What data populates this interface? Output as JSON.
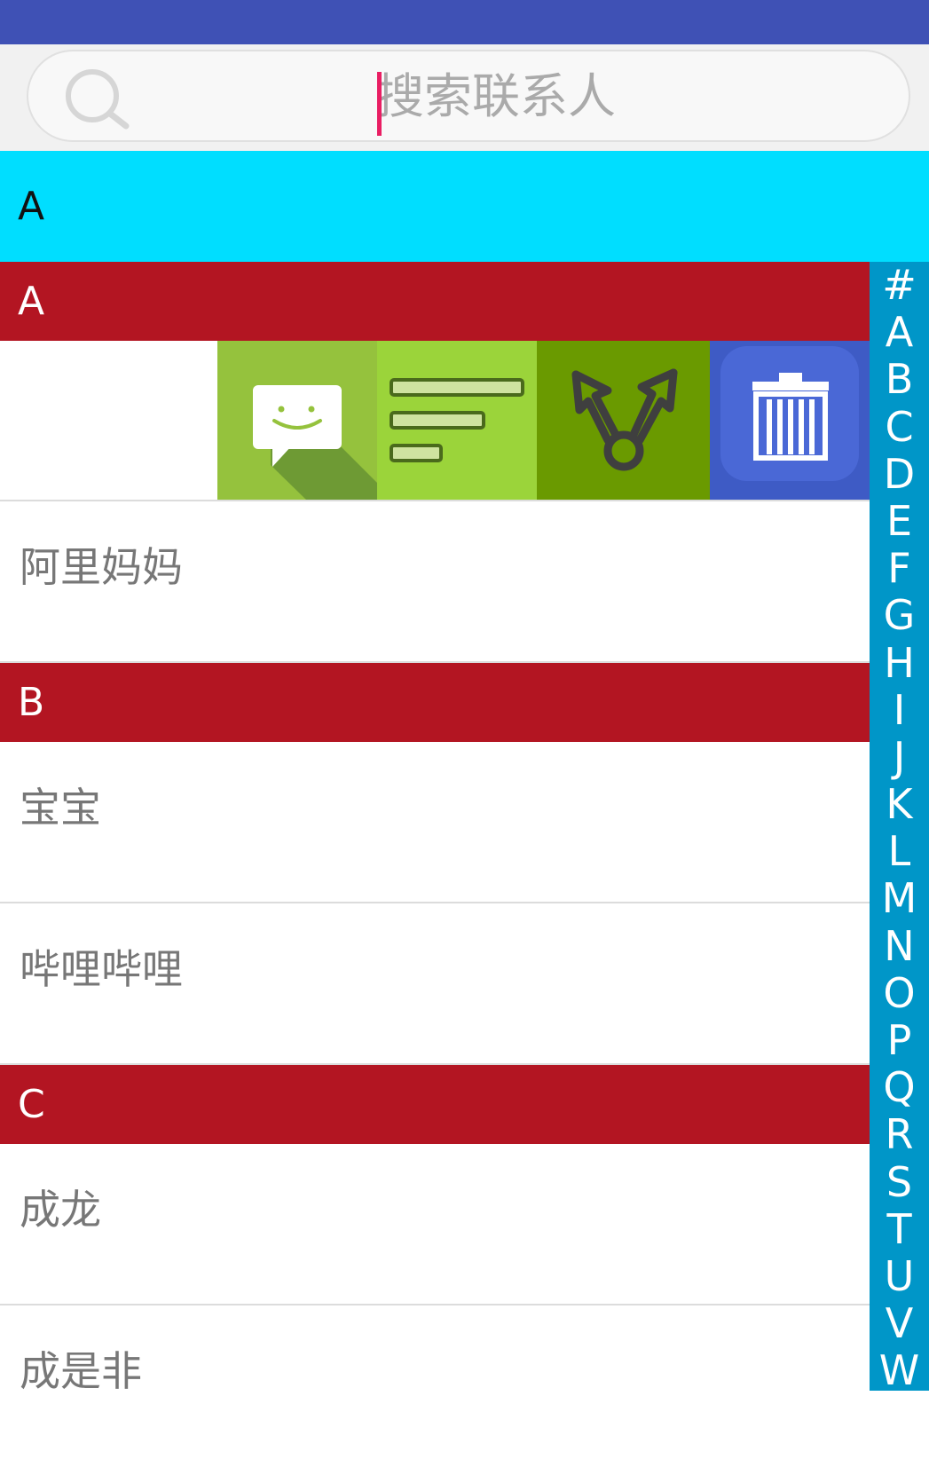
{
  "search": {
    "placeholder": "搜索联系人"
  },
  "sticky_header": "A",
  "sections": [
    {
      "letter": "A",
      "contacts": [
        "阿里妈妈"
      ]
    },
    {
      "letter": "B",
      "contacts": [
        "宝宝",
        "哔哩哔哩"
      ]
    },
    {
      "letter": "C",
      "contacts": [
        "成龙",
        "成是非"
      ]
    }
  ],
  "swipe_actions": [
    {
      "icon": "message-smiley-icon",
      "color": "#95c23d"
    },
    {
      "icon": "list-lines-icon",
      "color": "#9bd43a"
    },
    {
      "icon": "share-arrows-icon",
      "color": "#6a9a00"
    },
    {
      "icon": "trash-icon",
      "color": "#3e5bc5"
    }
  ],
  "index_letters": [
    "#",
    "A",
    "B",
    "C",
    "D",
    "E",
    "F",
    "G",
    "H",
    "I",
    "J",
    "K",
    "L",
    "M",
    "N",
    "O",
    "P",
    "Q",
    "R",
    "S",
    "T",
    "U",
    "V",
    "W"
  ],
  "colors": {
    "status_bar": "#3f51b5",
    "sticky_header": "#00deff",
    "section_header": "#b31522",
    "index_bar": "#0096c8",
    "caret": "#e91e63"
  }
}
